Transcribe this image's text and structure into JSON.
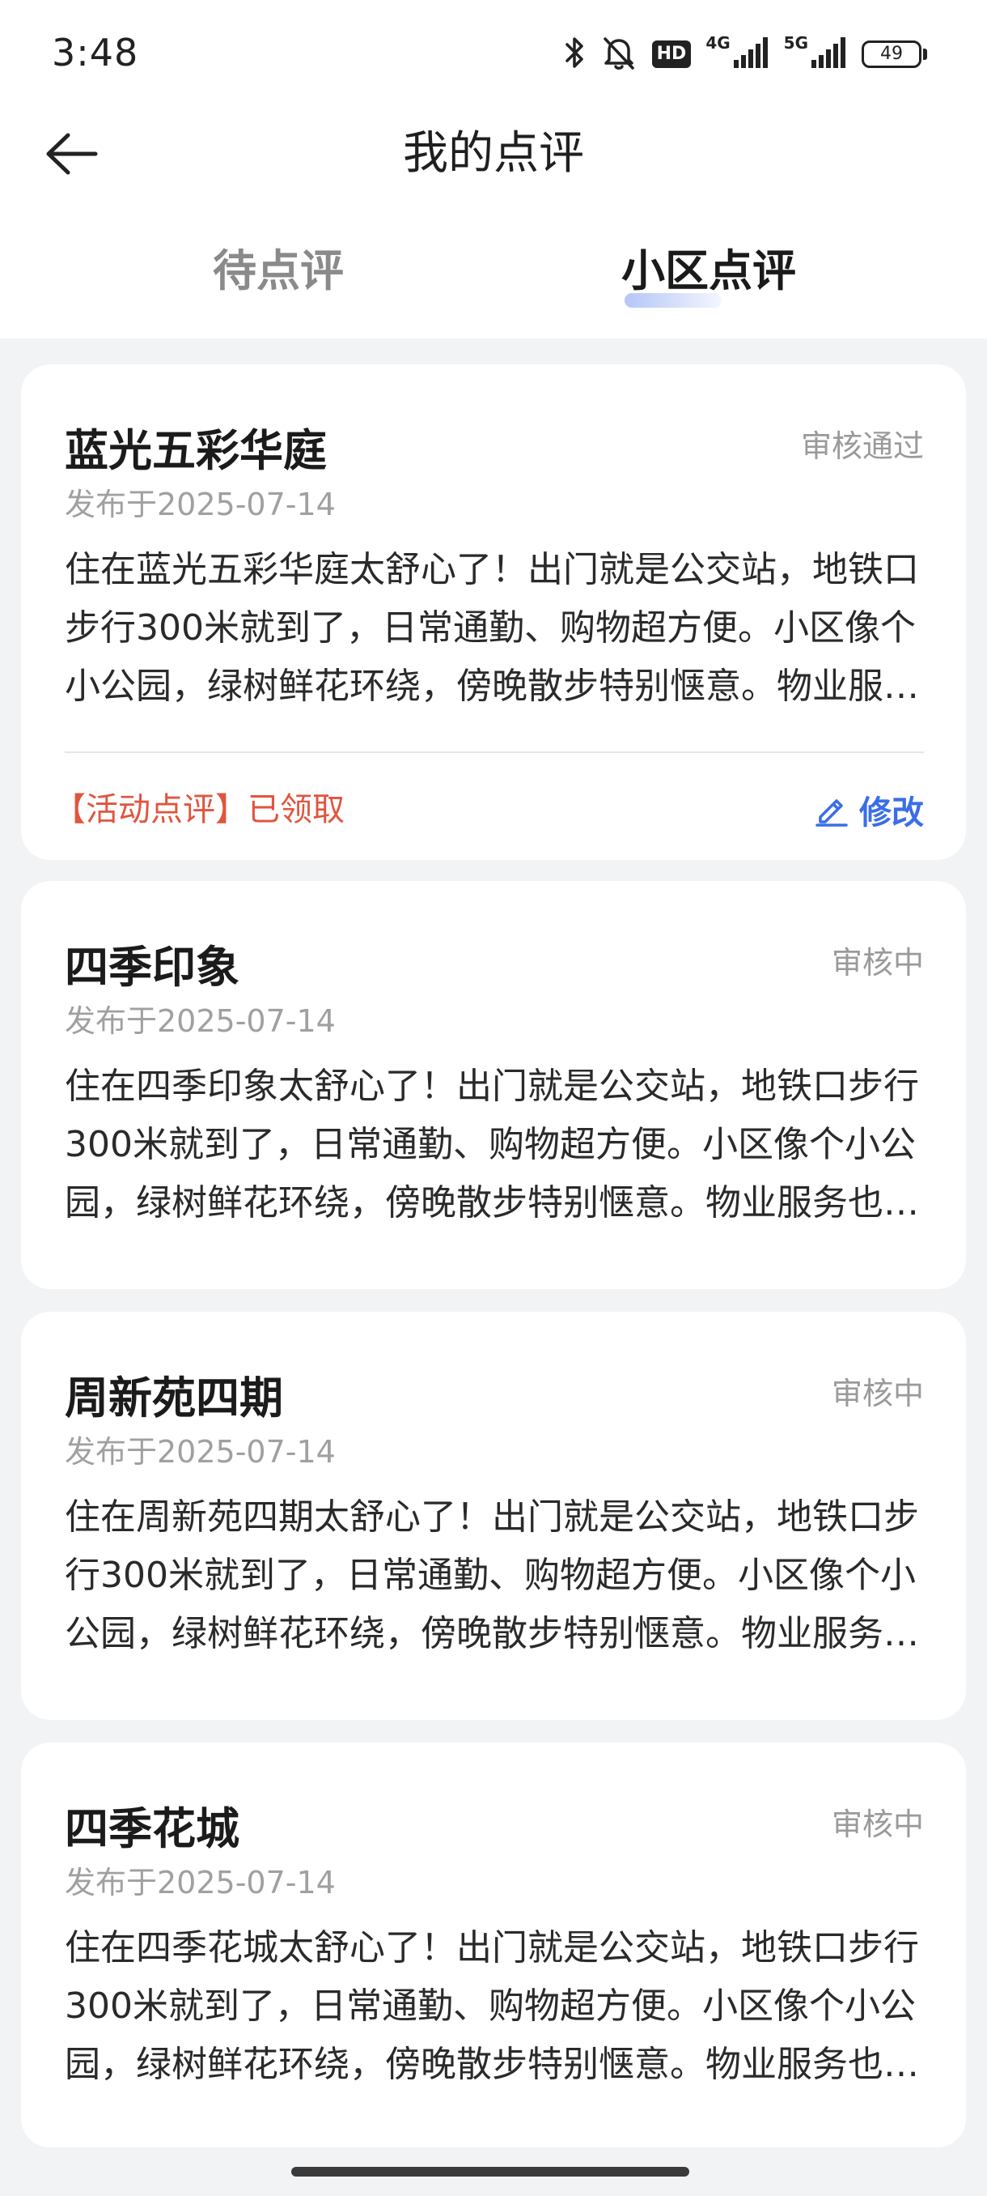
{
  "status_bar": {
    "time": "3:48",
    "hd_label": "HD",
    "net1_label": "4G",
    "net2_label": "5G",
    "battery": "49"
  },
  "nav": {
    "title": "我的点评"
  },
  "tabs": [
    {
      "label": "待点评",
      "active": false
    },
    {
      "label": "小区点评",
      "active": true
    }
  ],
  "reviews": [
    {
      "title": "蓝光五彩华庭",
      "status": "审核通过",
      "date": "发布于2025-07-14",
      "body": "住在蓝光五彩华庭太舒心了！出门就是公交站，地铁口步行300米就到了，日常通勤、购物超方便。小区像个小公园，绿树鲜花环绕，傍晚散步特别惬意。物业服务也很贴心。",
      "activity_label": "【活动点评】已领取",
      "edit_label": "修改"
    },
    {
      "title": "四季印象",
      "status": "审核中",
      "date": "发布于2025-07-14",
      "body": "住在四季印象太舒心了！出门就是公交站，地铁口步行300米就到了，日常通勤、购物超方便。小区像个小公园，绿树鲜花环绕，傍晚散步特别惬意。物业服务也很贴心。"
    },
    {
      "title": "周新苑四期",
      "status": "审核中",
      "date": "发布于2025-07-14",
      "body": "住在周新苑四期太舒心了！出门就是公交站，地铁口步行300米就到了，日常通勤、购物超方便。小区像个小公园，绿树鲜花环绕，傍晚散步特别惬意。物业服务也很贴心。"
    },
    {
      "title": "四季花城",
      "status": "审核中",
      "date": "发布于2025-07-14",
      "body": "住在四季花城太舒心了！出门就是公交站，地铁口步行300米就到了，日常通勤、购物超方便。小区像个小公园，绿树鲜花环绕，傍晚散步特别惬意。物业服务也很贴心。"
    }
  ],
  "colors": {
    "accent_blue": "#3a6ee8",
    "activity_red": "#e0553f",
    "background": "#f2f3f5"
  },
  "icons": {
    "back": "arrow-left-icon",
    "edit": "pencil-icon"
  }
}
